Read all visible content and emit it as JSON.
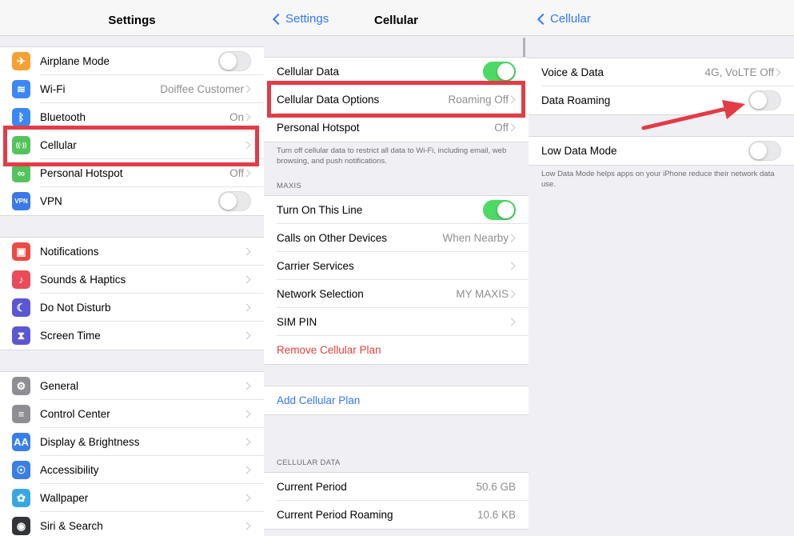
{
  "settings": {
    "title": "Settings",
    "group1": [
      {
        "label": "Airplane Mode",
        "icon": "airplane-icon",
        "color": "#f7a133",
        "glyph": "✈",
        "control": "toggle-off"
      },
      {
        "label": "Wi-Fi",
        "icon": "wifi-icon",
        "color": "#3b88f5",
        "glyph": "≋",
        "value": "Doiffee Customer"
      },
      {
        "label": "Bluetooth",
        "icon": "bluetooth-icon",
        "color": "#3b88f5",
        "glyph": "ᛒ",
        "value": "On"
      },
      {
        "label": "Cellular",
        "icon": "cellular-antenna-icon",
        "color": "#55c35c",
        "glyph": "((·))",
        "value": ""
      },
      {
        "label": "Personal Hotspot",
        "icon": "hotspot-icon",
        "color": "#55c35c",
        "glyph": "∞",
        "value": "Off"
      },
      {
        "label": "VPN",
        "icon": "vpn-icon",
        "color": "#3b79e6",
        "glyph": "VPN",
        "control": "toggle-off"
      }
    ],
    "group2": [
      {
        "label": "Notifications",
        "icon": "notifications-icon",
        "color": "#ec4a42",
        "glyph": "▣"
      },
      {
        "label": "Sounds & Haptics",
        "icon": "speaker-icon",
        "color": "#ea4b5b",
        "glyph": "♪"
      },
      {
        "label": "Do Not Disturb",
        "icon": "moon-icon",
        "color": "#5b57d4",
        "glyph": "☾"
      },
      {
        "label": "Screen Time",
        "icon": "hourglass-icon",
        "color": "#5b57d4",
        "glyph": "⧗"
      }
    ],
    "group3": [
      {
        "label": "General",
        "icon": "gear-icon",
        "color": "#8e8e93",
        "glyph": "⚙"
      },
      {
        "label": "Control Center",
        "icon": "switches-icon",
        "color": "#8e8e93",
        "glyph": "≡"
      },
      {
        "label": "Display & Brightness",
        "icon": "display-icon",
        "color": "#3a7fe8",
        "glyph": "AA"
      },
      {
        "label": "Accessibility",
        "icon": "accessibility-icon",
        "color": "#3a7fe8",
        "glyph": "☉"
      },
      {
        "label": "Wallpaper",
        "icon": "wallpaper-flower-icon",
        "color": "#39a8e0",
        "glyph": "✿"
      },
      {
        "label": "Siri & Search",
        "icon": "siri-icon",
        "color": "#333438",
        "glyph": "◉"
      }
    ]
  },
  "cellular": {
    "back_label": "Settings",
    "title": "Cellular",
    "group1": [
      {
        "label": "Cellular Data",
        "control": "toggle-on"
      },
      {
        "label": "Cellular Data Options",
        "value": "Roaming Off"
      },
      {
        "label": "Personal Hotspot",
        "value": "Off"
      }
    ],
    "footer": "Turn off cellular data to restrict all data to Wi-Fi, including email, web browsing, and push notifications.",
    "carrier_header": "MAXIS",
    "group2": [
      {
        "label": "Turn On This Line",
        "control": "toggle-on"
      },
      {
        "label": "Calls on Other Devices",
        "value": "When Nearby"
      },
      {
        "label": "Carrier Services",
        "value": ""
      },
      {
        "label": "Network Selection",
        "value": "MY MAXIS"
      },
      {
        "label": "SIM PIN",
        "value": ""
      },
      {
        "label": "Remove Cellular Plan",
        "style": "red"
      }
    ],
    "add_plan": "Add Cellular Plan",
    "usage_header": "CELLULAR DATA",
    "usage": [
      {
        "label": "Current Period",
        "value": "50.6 GB"
      },
      {
        "label": "Current Period Roaming",
        "value": "10.6 KB"
      }
    ]
  },
  "cellular_options": {
    "back_label": "Cellular",
    "group1": [
      {
        "label": "Voice & Data",
        "value": "4G, VoLTE Off"
      },
      {
        "label": "Data Roaming",
        "control": "toggle-off"
      }
    ],
    "group2": [
      {
        "label": "Low Data Mode",
        "control": "toggle-off"
      }
    ],
    "footer": "Low Data Mode helps apps on your iPhone reduce their network data use."
  },
  "colors": {
    "accent": "#3478f6",
    "highlight": "#e23c47",
    "toggle_on": "#4cd964",
    "destructive": "#e6403a"
  }
}
